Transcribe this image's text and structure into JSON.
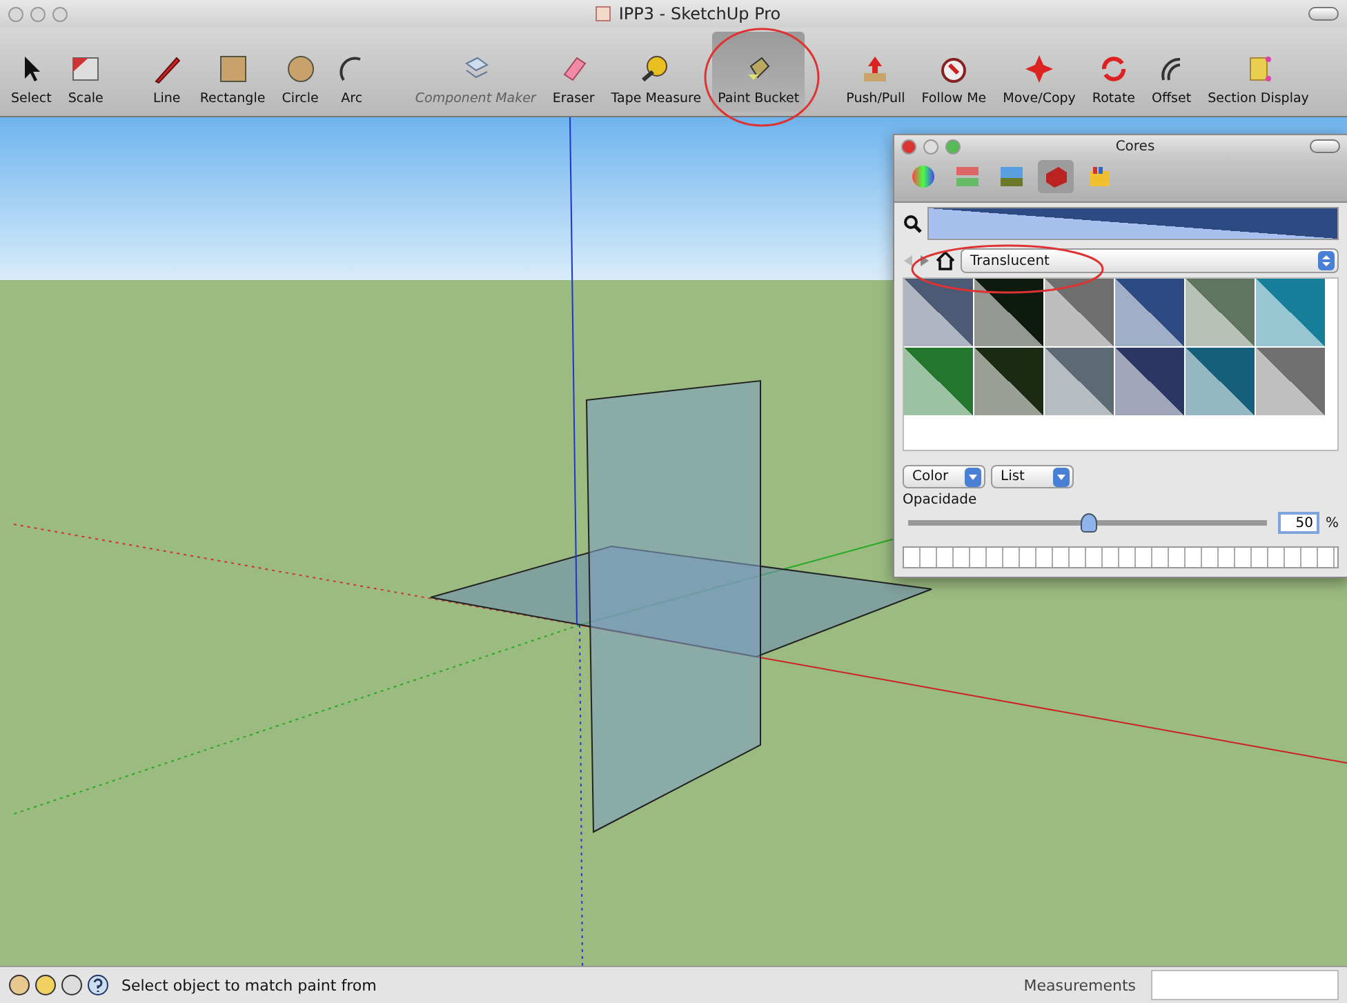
{
  "window": {
    "title": "IPP3 - SketchUp Pro"
  },
  "toolbar": {
    "groups": [
      {
        "tools": [
          {
            "label": "Select",
            "selected": false,
            "disabled": false
          },
          {
            "label": "Scale",
            "selected": false,
            "disabled": false
          }
        ]
      },
      {
        "tools": [
          {
            "label": "Line",
            "selected": false,
            "disabled": false
          },
          {
            "label": "Rectangle",
            "selected": false,
            "disabled": false
          },
          {
            "label": "Circle",
            "selected": false,
            "disabled": false
          },
          {
            "label": "Arc",
            "selected": false,
            "disabled": false
          }
        ]
      },
      {
        "tools": [
          {
            "label": "Component Maker",
            "selected": false,
            "disabled": true
          },
          {
            "label": "Eraser",
            "selected": false,
            "disabled": false
          },
          {
            "label": "Tape Measure",
            "selected": false,
            "disabled": false
          },
          {
            "label": "Paint Bucket",
            "selected": true,
            "disabled": false
          }
        ]
      },
      {
        "tools": [
          {
            "label": "Push/Pull",
            "selected": false,
            "disabled": false
          },
          {
            "label": "Follow Me",
            "selected": false,
            "disabled": false
          },
          {
            "label": "Move/Copy",
            "selected": false,
            "disabled": false
          },
          {
            "label": "Rotate",
            "selected": false,
            "disabled": false
          },
          {
            "label": "Offset",
            "selected": false,
            "disabled": false
          },
          {
            "label": "Section Display",
            "selected": false,
            "disabled": false
          }
        ]
      }
    ]
  },
  "colors_panel": {
    "title": "Cores",
    "tabs": [
      {
        "selected": false
      },
      {
        "selected": false
      },
      {
        "selected": false
      },
      {
        "selected": true
      },
      {
        "selected": false
      }
    ],
    "library": "Translucent",
    "swatches": [
      {
        "color": "#4b5b75"
      },
      {
        "color": "#0f1a0e"
      },
      {
        "color": "#6e6e6e"
      },
      {
        "color": "#2d4a82"
      },
      {
        "color": "#5f7560"
      },
      {
        "color": "#177f9a"
      },
      {
        "color": "#23772e"
      },
      {
        "color": "#1c2a12"
      },
      {
        "color": "#5c6a74"
      },
      {
        "color": "#2b3866"
      },
      {
        "color": "#145f7a"
      },
      {
        "color": "#707070"
      }
    ],
    "dropdowns": [
      "Color",
      "List"
    ],
    "opacity": {
      "label": "Opacidade",
      "level": 0.5,
      "value": "50",
      "unit": "%"
    }
  },
  "status_bar": {
    "hint": "Select object to match paint from",
    "measurements_label": "Measurements"
  }
}
